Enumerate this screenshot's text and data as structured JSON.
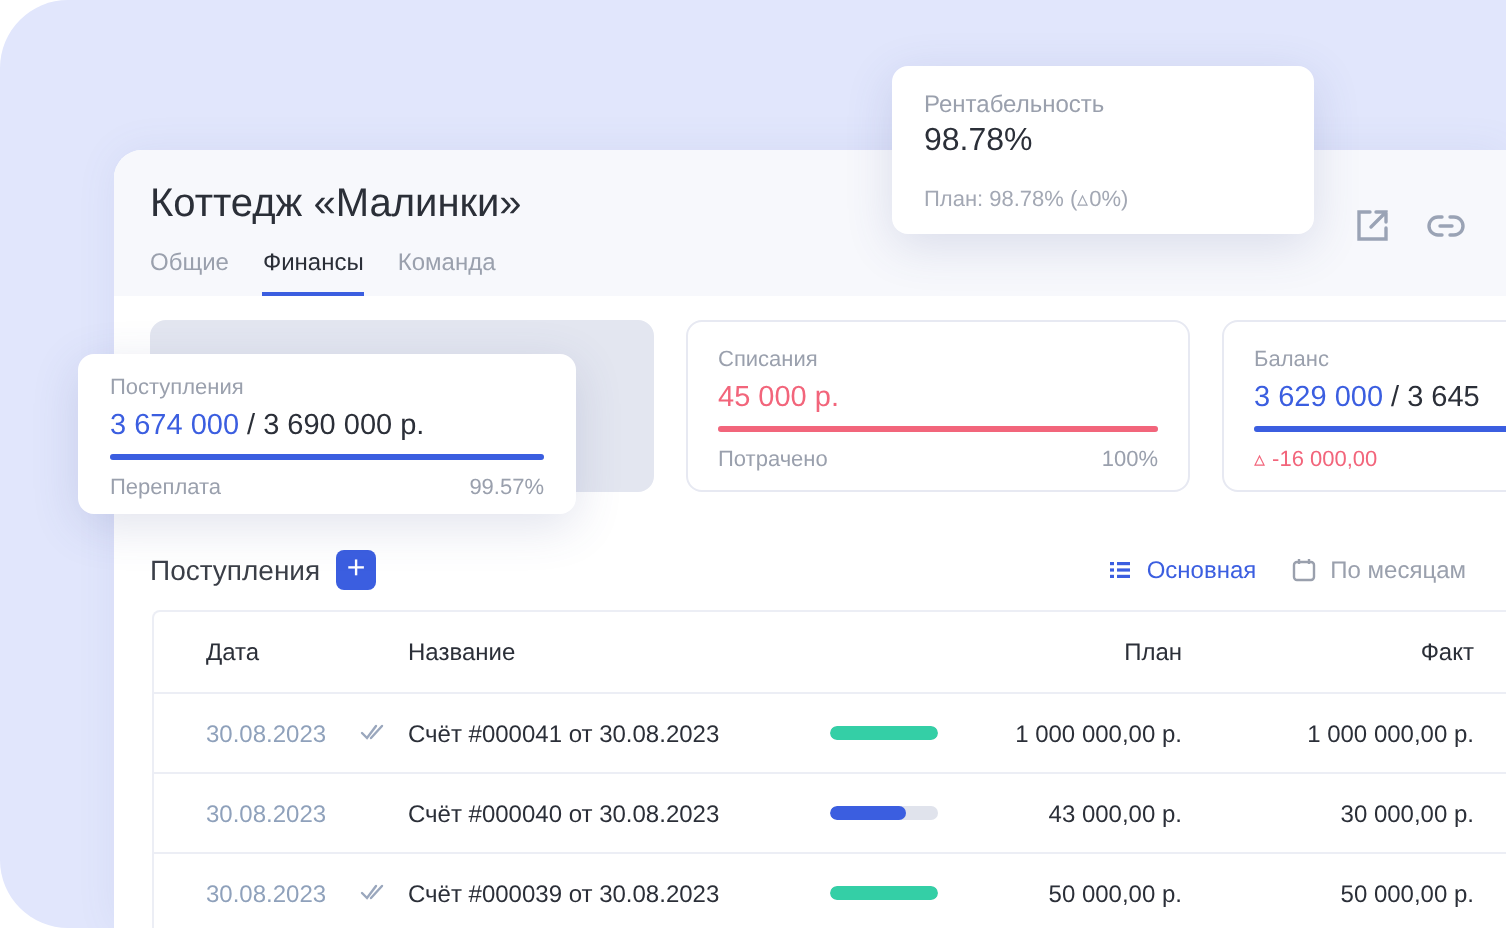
{
  "project": {
    "title": "Коттедж «Малинки»"
  },
  "tabs": [
    {
      "label": "Общие",
      "selected": false
    },
    {
      "label": "Финансы",
      "selected": true
    },
    {
      "label": "Команда",
      "selected": false
    }
  ],
  "profitability": {
    "label": "Рентабельность",
    "value": "98.78%",
    "plan": "План: 98.78% (▵0%)"
  },
  "income": {
    "label": "Поступления",
    "amount": "3 674 000",
    "total": "/ 3 690 000 р.",
    "level": 1,
    "footer_label": "Переплата",
    "footer_value": "99.57%"
  },
  "writeoffs": {
    "label": "Списания",
    "amount": "45 000 р.",
    "level": 1,
    "footer_label": "Потрачено",
    "footer_value": "100%"
  },
  "balance": {
    "label": "Баланс",
    "amount": "3 629 000",
    "total": "/ 3 645",
    "level": 1,
    "delta": "▵ -16 000,00"
  },
  "section": {
    "title": "Поступления",
    "add_button": "+"
  },
  "views": [
    {
      "label": "Основная",
      "selected": true
    },
    {
      "label": "По месяцам",
      "selected": false
    }
  ],
  "table": {
    "columns": [
      "Дата",
      "Название",
      "План",
      "Факт"
    ],
    "rows": [
      {
        "date": "30.08.2023",
        "paid": true,
        "name": "Счёт #000041 от 30.08.2023",
        "level": 1,
        "plan": "1 000 000,00 р.",
        "fact": "1 000 000,00 р."
      },
      {
        "date": "30.08.2023",
        "paid": false,
        "name": "Счёт #000040 от 30.08.2023",
        "level": 0.7,
        "plan": "43 000,00 р.",
        "fact": "30 000,00 р."
      },
      {
        "date": "30.08.2023",
        "paid": true,
        "name": "Счёт #000039 от 30.08.2023",
        "level": 1,
        "plan": "50 000,00 р.",
        "fact": "50 000,00 р."
      }
    ]
  }
}
